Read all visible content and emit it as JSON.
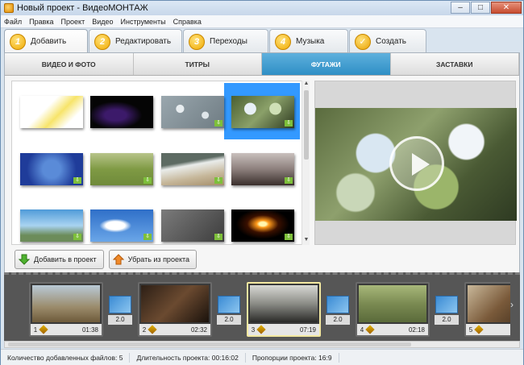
{
  "window": {
    "title": "Новый проект - ВидеоМОНТАЖ",
    "buttons": [
      "–",
      "□",
      "✕"
    ]
  },
  "menu": [
    "Файл",
    "Правка",
    "Проект",
    "Видео",
    "Инструменты",
    "Справка"
  ],
  "steps": [
    {
      "num": "1",
      "label": "Добавить",
      "active": true
    },
    {
      "num": "2",
      "label": "Редактировать"
    },
    {
      "num": "3",
      "label": "Переходы"
    },
    {
      "num": "4",
      "label": "Музыка"
    },
    {
      "num": "✓",
      "label": "Создать"
    }
  ],
  "categories": [
    {
      "label": "ВИДЕО И ФОТО"
    },
    {
      "label": "ТИТРЫ"
    },
    {
      "label": "ФУТАЖИ",
      "active": true
    },
    {
      "label": "ЗАСТАВКИ"
    }
  ],
  "actions": {
    "add": "Добавить в проект",
    "remove": "Убрать из проекта"
  },
  "timeline": {
    "clips": [
      {
        "num": "1",
        "time": "01:38"
      },
      {
        "num": "2",
        "time": "02:32"
      },
      {
        "num": "3",
        "time": "07:19",
        "selected": true
      },
      {
        "num": "4",
        "time": "02:18"
      },
      {
        "num": "5",
        "time": ""
      }
    ],
    "transitions": [
      "2.0",
      "2.0",
      "2.0",
      "2.0"
    ]
  },
  "status": {
    "files": "Количество добавленных файлов: 5",
    "duration": "Длительность проекта: 00:16:02",
    "ratio": "Пропорции проекта: 16:9"
  }
}
